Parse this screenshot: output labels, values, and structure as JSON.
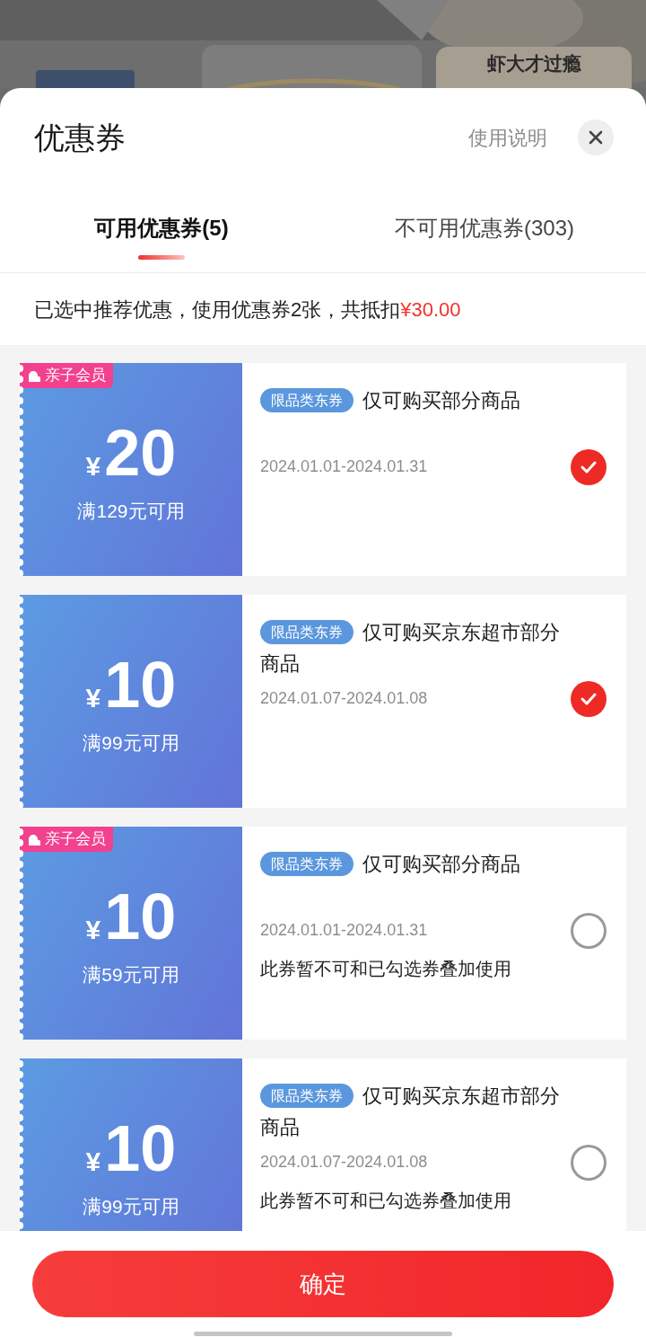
{
  "background": {
    "kind": "picture",
    "headline": "虾大才过瘾"
  },
  "sheet": {
    "title": "优惠券",
    "help_link": "使用说明"
  },
  "tabs": [
    {
      "label": "可用优惠券(5)",
      "selected": true
    },
    {
      "label": "不可用优惠券(303)",
      "selected": false
    }
  ],
  "summary": {
    "text": "已选中推荐优惠，使用优惠券2张，共抵扣",
    "amount": "¥30.00"
  },
  "coupons": [
    {
      "badge": "亲子会员",
      "currency": "¥",
      "amount": "20",
      "condition": "满129元可用",
      "tag": "限品类东券",
      "title": "仅可购买部分商品",
      "validity": "2024.01.01-2024.01.31",
      "selected": true
    },
    {
      "currency": "¥",
      "amount": "10",
      "condition": "满99元可用",
      "tag": "限品类东券",
      "title": "仅可购买京东超市部分商品",
      "validity": "2024.01.07-2024.01.08",
      "selected": true
    },
    {
      "badge": "亲子会员",
      "currency": "¥",
      "amount": "10",
      "condition": "满59元可用",
      "tag": "限品类东券",
      "title": "仅可购买部分商品",
      "validity": "2024.01.01-2024.01.31",
      "note": "此券暂不可和已勾选券叠加使用",
      "selected": false
    },
    {
      "currency": "¥",
      "amount": "10",
      "condition": "满99元可用",
      "tag": "限品类东券",
      "title": "仅可购买京东超市部分商品",
      "validity": "2024.01.07-2024.01.08",
      "note": "此券暂不可和已勾选券叠加使用",
      "selected": false
    }
  ],
  "confirm_button": "确定"
}
